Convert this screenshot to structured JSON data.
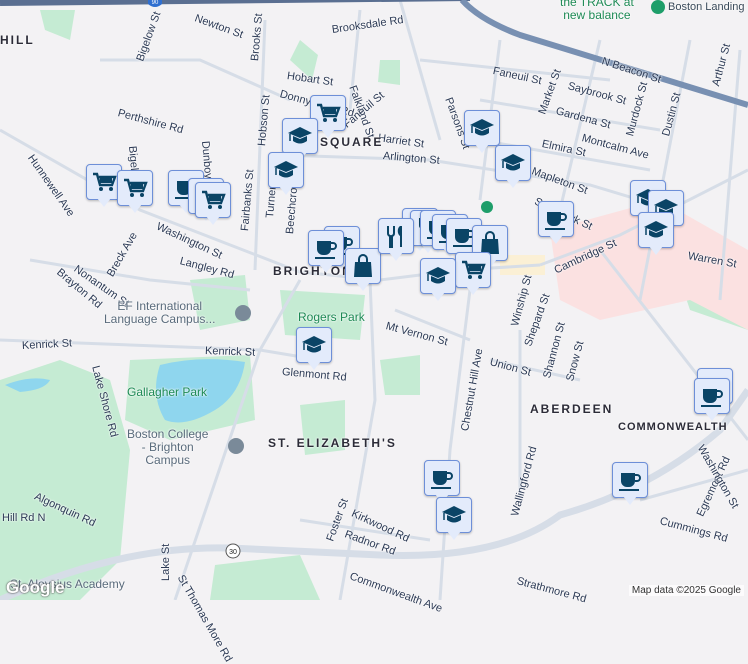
{
  "map": {
    "colors": {
      "background": "#f3f2f4",
      "park": "#c5ebd3",
      "water": "#8fd6ee",
      "highway": "#7890b2",
      "road": "#d6dde7",
      "hospital": "#fbe1e1",
      "marker_fill": "#e3ebfb",
      "marker_icon": "#0a4466"
    },
    "highway_shields": [
      "90",
      "30"
    ],
    "streets": [
      "Newton St",
      "Brooksdale Rd",
      "Brooks St",
      "Hobart St",
      "Falkland St",
      "Donnybrook Rd",
      "Faneuil St",
      "Bigelow St",
      "Perthshire Rd",
      "Dunboy St",
      "Hobson St",
      "Hunnewell Ave",
      "Bigelow St",
      "Fairbanks St",
      "Turner St",
      "Beechcroft St",
      "Washington St",
      "Nonantum St",
      "Breck Ave",
      "Langley Rd",
      "Brayton Rd",
      "Faneuil St",
      "Parsons St",
      "Market St",
      "N Beacon St",
      "Saybrook St",
      "Gardena St",
      "Murdock St",
      "Dustin St",
      "Arthur St",
      "Harriet St",
      "Arlington St",
      "Elmira St",
      "Montcalm Ave",
      "Mapleton St",
      "Sparhawk St",
      "Cambridge St",
      "Warren St",
      "Kenrick St",
      "Kenrick St",
      "Glenmont Rd",
      "Lake Shore Rd",
      "Mt Vernon St",
      "Union St",
      "Winship St",
      "Shepard St",
      "Shannon St",
      "Snow St",
      "Chestnut Hill Ave",
      "Wallingford Rd",
      "Algonquin Rd",
      "Hill Rd N",
      "Lake St",
      "Foster St",
      "Kirkwood Rd",
      "Radnor Rd",
      "Commonwealth Ave",
      "St Thomas More Rd",
      "Strathmore Rd",
      "Egremont Rd",
      "Cummings Rd",
      "Washington St"
    ],
    "neighborhoods": [
      "HILL",
      "SQUARE",
      "BRIGHTON",
      "ST. ELIZABETH'S",
      "ABERDEEN",
      "COMMONWEALTH"
    ],
    "parks": [
      "Rogers Park",
      "Gallagher Park"
    ],
    "pois": [
      "EF International\nLanguage Campus...",
      "Boston College\n- Brighton\nCampus",
      "the TRACK at\nnew balance",
      "Boston Landing",
      "St. Aloysius Academy"
    ],
    "markers": [
      {
        "type": "shopping-cart"
      },
      {
        "type": "school"
      },
      {
        "type": "school"
      },
      {
        "type": "shopping-cart"
      },
      {
        "type": "shopping-cart"
      },
      {
        "type": "coffee"
      },
      {
        "type": "coffee"
      },
      {
        "type": "shopping-cart"
      },
      {
        "type": "coffee"
      },
      {
        "type": "coffee"
      },
      {
        "type": "shopping-bag"
      },
      {
        "type": "restaurant"
      },
      {
        "type": "restaurant"
      },
      {
        "type": "restaurant"
      },
      {
        "type": "coffee"
      },
      {
        "type": "coffee"
      },
      {
        "type": "coffee"
      },
      {
        "type": "shopping-bag"
      },
      {
        "type": "shopping-cart"
      },
      {
        "type": "school"
      },
      {
        "type": "school"
      },
      {
        "type": "school"
      },
      {
        "type": "coffee"
      },
      {
        "type": "school"
      },
      {
        "type": "school"
      },
      {
        "type": "school"
      },
      {
        "type": "school"
      },
      {
        "type": "coffee"
      },
      {
        "type": "coffee"
      },
      {
        "type": "coffee"
      },
      {
        "type": "school"
      },
      {
        "type": "coffee"
      }
    ],
    "attribution": "Map data ©2025 Google",
    "logo": "Google"
  }
}
